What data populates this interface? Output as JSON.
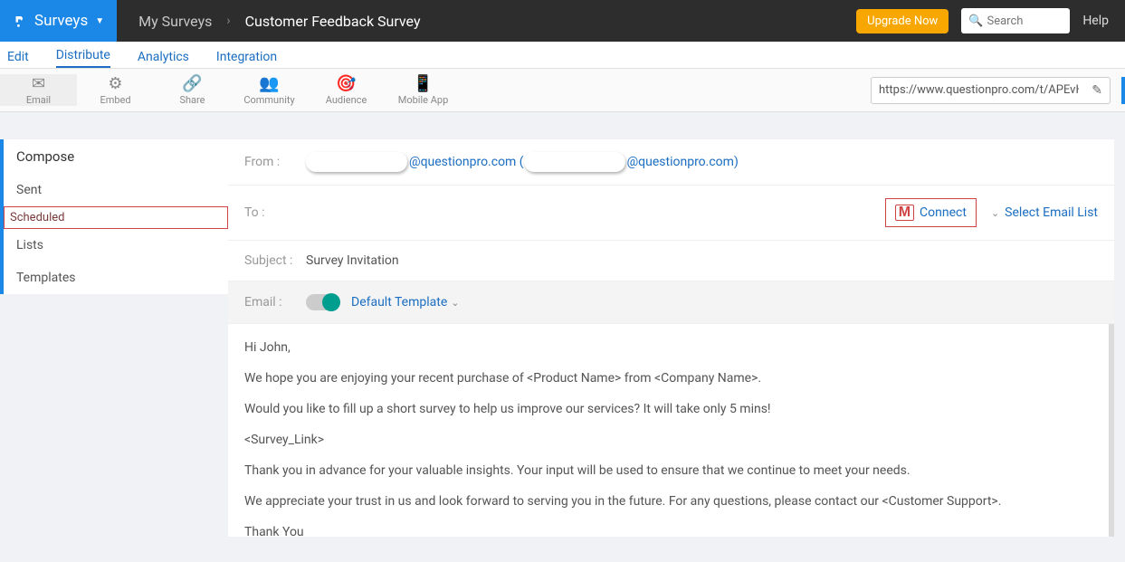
{
  "header": {
    "brand_label": "Surveys",
    "breadcrumb_root": "My Surveys",
    "breadcrumb_current": "Customer Feedback Survey",
    "upgrade": "Upgrade Now",
    "search_placeholder": "Search",
    "help": "Help"
  },
  "tabs": {
    "edit": "Edit",
    "distribute": "Distribute",
    "analytics": "Analytics",
    "integration": "Integration"
  },
  "toolbar": {
    "email": "Email",
    "embed": "Embed",
    "share": "Share",
    "community": "Community",
    "audience": "Audience",
    "mobile": "Mobile App",
    "url": "https://www.questionpro.com/t/APEvHZeq"
  },
  "sidemenu": {
    "compose": "Compose",
    "sent": "Sent",
    "scheduled": "Scheduled",
    "lists": "Lists",
    "templates": "Templates"
  },
  "compose": {
    "from_label": "From :",
    "from_domain1": "@questionpro.com (",
    "from_domain2": "@questionpro.com)",
    "to_label": "To :",
    "connect": "Connect",
    "select_list": "Select Email List",
    "subject_label": "Subject :",
    "subject_value": "Survey Invitation",
    "email_label": "Email :",
    "template_label": "Default Template",
    "body": {
      "p1": "Hi John,",
      "p2": "We hope you are enjoying your recent purchase of <Product Name> from <Company Name>.",
      "p3": "Would you like to fill up a short survey to help us improve our services? It will take only 5 mins!",
      "p4": "<Survey_Link>",
      "p5": "Thank you in advance for your valuable insights.  Your input will be used to ensure that we continue to meet your needs.",
      "p6": "We appreciate your trust in us and look forward to serving you in the future. For any questions, please contact our <Customer Support>.",
      "p7": "Thank You"
    }
  }
}
